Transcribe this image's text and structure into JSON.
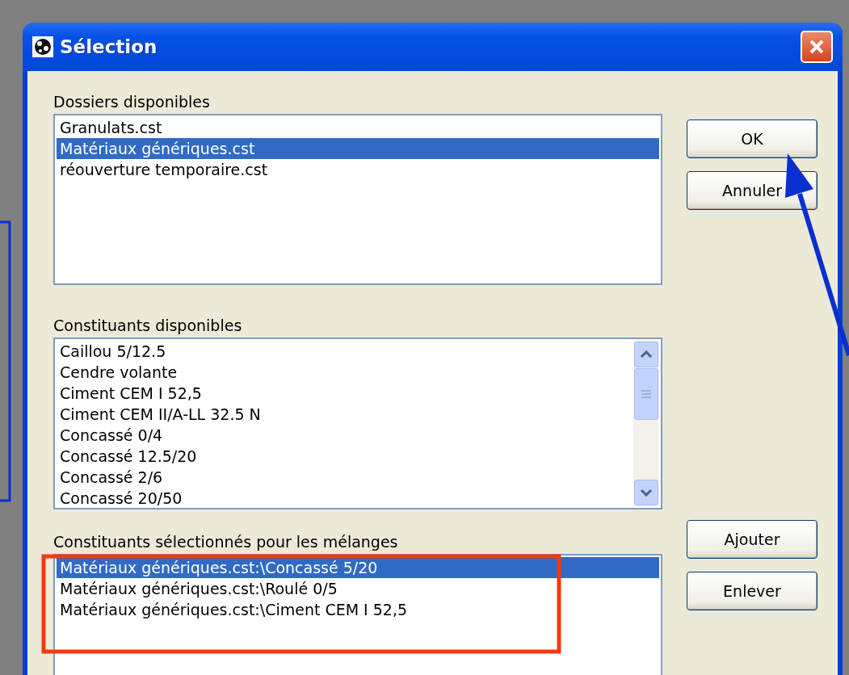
{
  "window": {
    "title": "Sélection"
  },
  "folders": {
    "label": "Dossiers disponibles",
    "items": [
      {
        "text": "Granulats.cst",
        "selected": false
      },
      {
        "text": "Matériaux génériques.cst",
        "selected": true
      },
      {
        "text": "réouverture temporaire.cst",
        "selected": false
      }
    ]
  },
  "components": {
    "label": "Constituants disponibles",
    "items": [
      {
        "text": "Caillou 5/12.5",
        "selected": false
      },
      {
        "text": "Cendre volante",
        "selected": false
      },
      {
        "text": "Ciment CEM I 52,5",
        "selected": false
      },
      {
        "text": "Ciment CEM II/A-LL 32.5 N",
        "selected": false
      },
      {
        "text": "Concassé 0/4",
        "selected": false
      },
      {
        "text": "Concassé 12.5/20",
        "selected": false
      },
      {
        "text": "Concassé 2/6",
        "selected": false
      },
      {
        "text": "Concassé 20/50",
        "selected": false
      }
    ]
  },
  "selected_components": {
    "label": "Constituants sélectionnés pour les mélanges",
    "items": [
      {
        "text": "Matériaux génériques.cst:\\Concassé 5/20",
        "selected": true
      },
      {
        "text": "Matériaux génériques.cst:\\Roulé 0/5",
        "selected": false
      },
      {
        "text": "Matériaux génériques.cst:\\Ciment CEM I 52,5",
        "selected": false
      }
    ]
  },
  "top_buttons": [
    "OK",
    "Annuler"
  ],
  "bottom_buttons": [
    "Ajouter",
    "Enlever"
  ]
}
